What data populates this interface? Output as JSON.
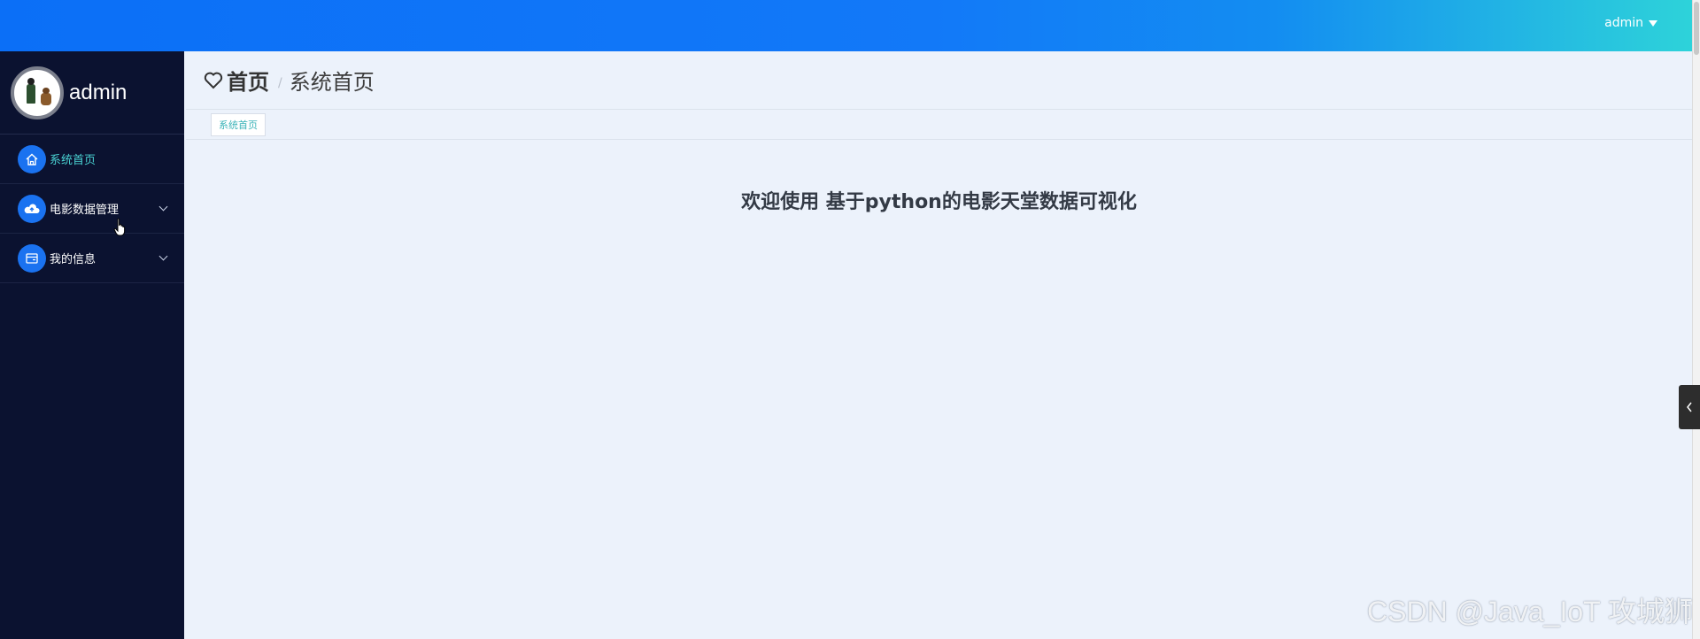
{
  "header": {
    "user_label": "admin"
  },
  "sidebar": {
    "profile_name": "admin",
    "items": [
      {
        "label": "系统首页",
        "icon": "home-icon",
        "active": true
      },
      {
        "label": "电影数据管理",
        "icon": "cloud-upload-icon",
        "expandable": true
      },
      {
        "label": "我的信息",
        "icon": "card-icon",
        "expandable": true
      }
    ]
  },
  "breadcrumb": {
    "home": "首页",
    "separator": "/",
    "current": "系统首页"
  },
  "tabs": [
    {
      "label": "系统首页"
    }
  ],
  "main": {
    "welcome": "欢迎使用 基于python的电影天堂数据可视化"
  },
  "watermark": "CSDN @Java_IoT 攻城狮",
  "colors": {
    "header_start": "#0b6ff7",
    "header_end": "#2ed4d9",
    "sidebar_bg": "#0b1230",
    "accent_teal": "#4ad3d3",
    "icon_blue": "#1a72f0",
    "content_bg": "#ecf2fb"
  }
}
